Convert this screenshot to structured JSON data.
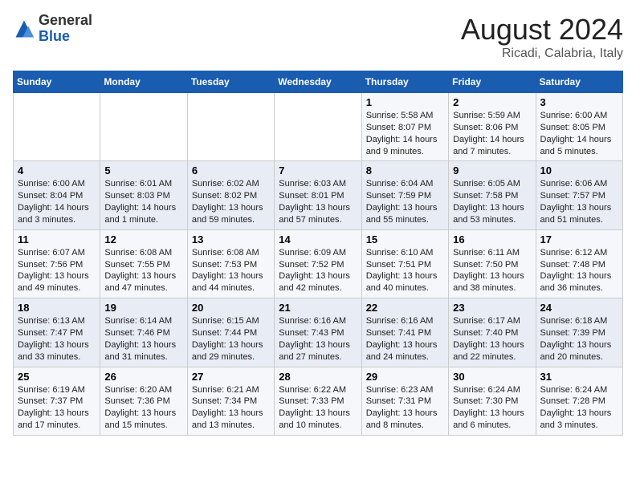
{
  "header": {
    "logo_general": "General",
    "logo_blue": "Blue",
    "title": "August 2024",
    "location": "Ricadi, Calabria, Italy"
  },
  "weekdays": [
    "Sunday",
    "Monday",
    "Tuesday",
    "Wednesday",
    "Thursday",
    "Friday",
    "Saturday"
  ],
  "weeks": [
    [
      {
        "day": "",
        "info": ""
      },
      {
        "day": "",
        "info": ""
      },
      {
        "day": "",
        "info": ""
      },
      {
        "day": "",
        "info": ""
      },
      {
        "day": "1",
        "info": "Sunrise: 5:58 AM\nSunset: 8:07 PM\nDaylight: 14 hours\nand 9 minutes."
      },
      {
        "day": "2",
        "info": "Sunrise: 5:59 AM\nSunset: 8:06 PM\nDaylight: 14 hours\nand 7 minutes."
      },
      {
        "day": "3",
        "info": "Sunrise: 6:00 AM\nSunset: 8:05 PM\nDaylight: 14 hours\nand 5 minutes."
      }
    ],
    [
      {
        "day": "4",
        "info": "Sunrise: 6:00 AM\nSunset: 8:04 PM\nDaylight: 14 hours\nand 3 minutes."
      },
      {
        "day": "5",
        "info": "Sunrise: 6:01 AM\nSunset: 8:03 PM\nDaylight: 14 hours\nand 1 minute."
      },
      {
        "day": "6",
        "info": "Sunrise: 6:02 AM\nSunset: 8:02 PM\nDaylight: 13 hours\nand 59 minutes."
      },
      {
        "day": "7",
        "info": "Sunrise: 6:03 AM\nSunset: 8:01 PM\nDaylight: 13 hours\nand 57 minutes."
      },
      {
        "day": "8",
        "info": "Sunrise: 6:04 AM\nSunset: 7:59 PM\nDaylight: 13 hours\nand 55 minutes."
      },
      {
        "day": "9",
        "info": "Sunrise: 6:05 AM\nSunset: 7:58 PM\nDaylight: 13 hours\nand 53 minutes."
      },
      {
        "day": "10",
        "info": "Sunrise: 6:06 AM\nSunset: 7:57 PM\nDaylight: 13 hours\nand 51 minutes."
      }
    ],
    [
      {
        "day": "11",
        "info": "Sunrise: 6:07 AM\nSunset: 7:56 PM\nDaylight: 13 hours\nand 49 minutes."
      },
      {
        "day": "12",
        "info": "Sunrise: 6:08 AM\nSunset: 7:55 PM\nDaylight: 13 hours\nand 47 minutes."
      },
      {
        "day": "13",
        "info": "Sunrise: 6:08 AM\nSunset: 7:53 PM\nDaylight: 13 hours\nand 44 minutes."
      },
      {
        "day": "14",
        "info": "Sunrise: 6:09 AM\nSunset: 7:52 PM\nDaylight: 13 hours\nand 42 minutes."
      },
      {
        "day": "15",
        "info": "Sunrise: 6:10 AM\nSunset: 7:51 PM\nDaylight: 13 hours\nand 40 minutes."
      },
      {
        "day": "16",
        "info": "Sunrise: 6:11 AM\nSunset: 7:50 PM\nDaylight: 13 hours\nand 38 minutes."
      },
      {
        "day": "17",
        "info": "Sunrise: 6:12 AM\nSunset: 7:48 PM\nDaylight: 13 hours\nand 36 minutes."
      }
    ],
    [
      {
        "day": "18",
        "info": "Sunrise: 6:13 AM\nSunset: 7:47 PM\nDaylight: 13 hours\nand 33 minutes."
      },
      {
        "day": "19",
        "info": "Sunrise: 6:14 AM\nSunset: 7:46 PM\nDaylight: 13 hours\nand 31 minutes."
      },
      {
        "day": "20",
        "info": "Sunrise: 6:15 AM\nSunset: 7:44 PM\nDaylight: 13 hours\nand 29 minutes."
      },
      {
        "day": "21",
        "info": "Sunrise: 6:16 AM\nSunset: 7:43 PM\nDaylight: 13 hours\nand 27 minutes."
      },
      {
        "day": "22",
        "info": "Sunrise: 6:16 AM\nSunset: 7:41 PM\nDaylight: 13 hours\nand 24 minutes."
      },
      {
        "day": "23",
        "info": "Sunrise: 6:17 AM\nSunset: 7:40 PM\nDaylight: 13 hours\nand 22 minutes."
      },
      {
        "day": "24",
        "info": "Sunrise: 6:18 AM\nSunset: 7:39 PM\nDaylight: 13 hours\nand 20 minutes."
      }
    ],
    [
      {
        "day": "25",
        "info": "Sunrise: 6:19 AM\nSunset: 7:37 PM\nDaylight: 13 hours\nand 17 minutes."
      },
      {
        "day": "26",
        "info": "Sunrise: 6:20 AM\nSunset: 7:36 PM\nDaylight: 13 hours\nand 15 minutes."
      },
      {
        "day": "27",
        "info": "Sunrise: 6:21 AM\nSunset: 7:34 PM\nDaylight: 13 hours\nand 13 minutes."
      },
      {
        "day": "28",
        "info": "Sunrise: 6:22 AM\nSunset: 7:33 PM\nDaylight: 13 hours\nand 10 minutes."
      },
      {
        "day": "29",
        "info": "Sunrise: 6:23 AM\nSunset: 7:31 PM\nDaylight: 13 hours\nand 8 minutes."
      },
      {
        "day": "30",
        "info": "Sunrise: 6:24 AM\nSunset: 7:30 PM\nDaylight: 13 hours\nand 6 minutes."
      },
      {
        "day": "31",
        "info": "Sunrise: 6:24 AM\nSunset: 7:28 PM\nDaylight: 13 hours\nand 3 minutes."
      }
    ]
  ]
}
